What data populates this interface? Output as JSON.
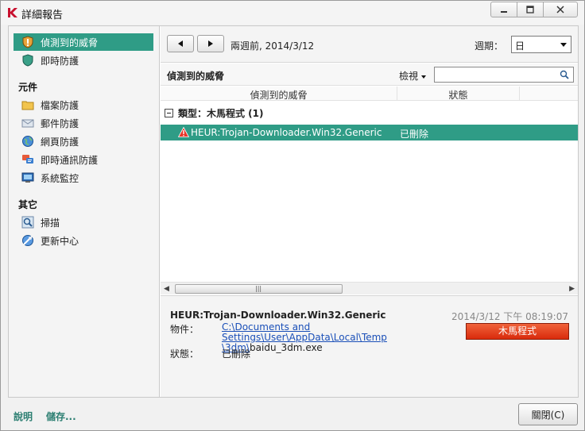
{
  "window": {
    "title": "詳細報告"
  },
  "sidebar": {
    "top_items": [
      {
        "label": "偵測到的威脅"
      },
      {
        "label": "即時防護"
      }
    ],
    "components_heading": "元件",
    "components": [
      {
        "label": "檔案防護"
      },
      {
        "label": "郵件防護"
      },
      {
        "label": "網頁防護"
      },
      {
        "label": "即時通訊防護"
      },
      {
        "label": "系統監控"
      }
    ],
    "other_heading": "其它",
    "other": [
      {
        "label": "掃描"
      },
      {
        "label": "更新中心"
      }
    ]
  },
  "toolbar": {
    "date_text": "兩週前, 2014/3/12",
    "period_label": "週期：",
    "period_value": "日"
  },
  "panel": {
    "title": "偵測到的威脅",
    "view_label": "檢視",
    "search_placeholder": ""
  },
  "table": {
    "columns": [
      "偵測到的威脅",
      "狀態"
    ],
    "group_label": "類型：木馬程式 (1)",
    "rows": [
      {
        "name": "HEUR:Trojan-Downloader.Win32.Generic",
        "status": "已刪除"
      }
    ]
  },
  "details": {
    "name": "HEUR:Trojan-Downloader.Win32.Generic",
    "timestamp": "2014/3/12 下午 08:19:07",
    "object_label": "物件：",
    "path_link_1": "C:\\Documents and Settings\\User\\AppData\\Local\\Temp",
    "path_link_2": "\\3dm\\",
    "path_file": "baidu_3dm.exe",
    "status_label": "狀態：",
    "status_value": "已刪除",
    "type_badge": "木馬程式"
  },
  "footer": {
    "help": "說明",
    "save": "儲存...",
    "close": "關閉(C)"
  },
  "colors": {
    "accent": "#2f9c86",
    "danger": "#d92b0c",
    "link": "#1a4fb8"
  }
}
